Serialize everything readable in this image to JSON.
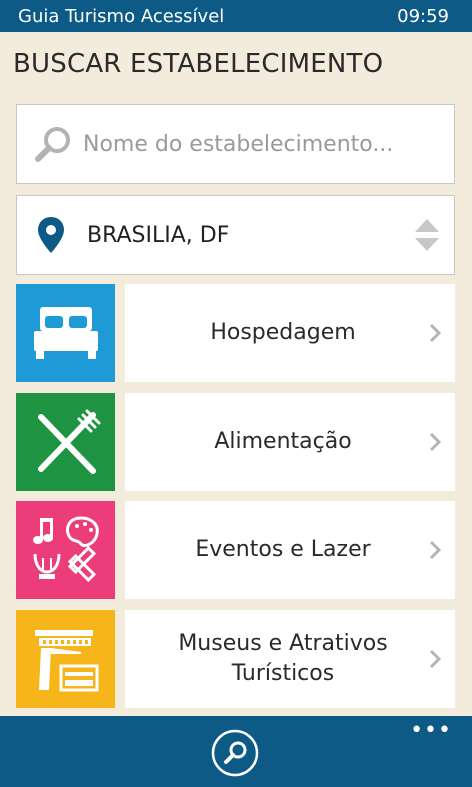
{
  "status_bar": {
    "app_name": "Guia Turismo Acessível",
    "time": "09:59"
  },
  "page": {
    "title": "BUSCAR ESTABELECIMENTO"
  },
  "search": {
    "placeholder": "Nome do estabelecimento..."
  },
  "location": {
    "value": "BRASILIA, DF"
  },
  "categories": [
    {
      "label": "Hospedagem",
      "icon": "bed-icon",
      "color": "#1e9ad6"
    },
    {
      "label": "Alimentação",
      "icon": "fork-knife-icon",
      "color": "#1e9443"
    },
    {
      "label": "Eventos e Lazer",
      "icon": "events-icon",
      "color": "#ec3c7a"
    },
    {
      "label": "Museus e Atrativos Turísticos",
      "icon": "museum-icon",
      "color": "#f6b518"
    }
  ],
  "app_bar": {
    "more_label": "•••"
  },
  "colors": {
    "accent": "#0d5a86",
    "background": "#f3ecdc"
  }
}
